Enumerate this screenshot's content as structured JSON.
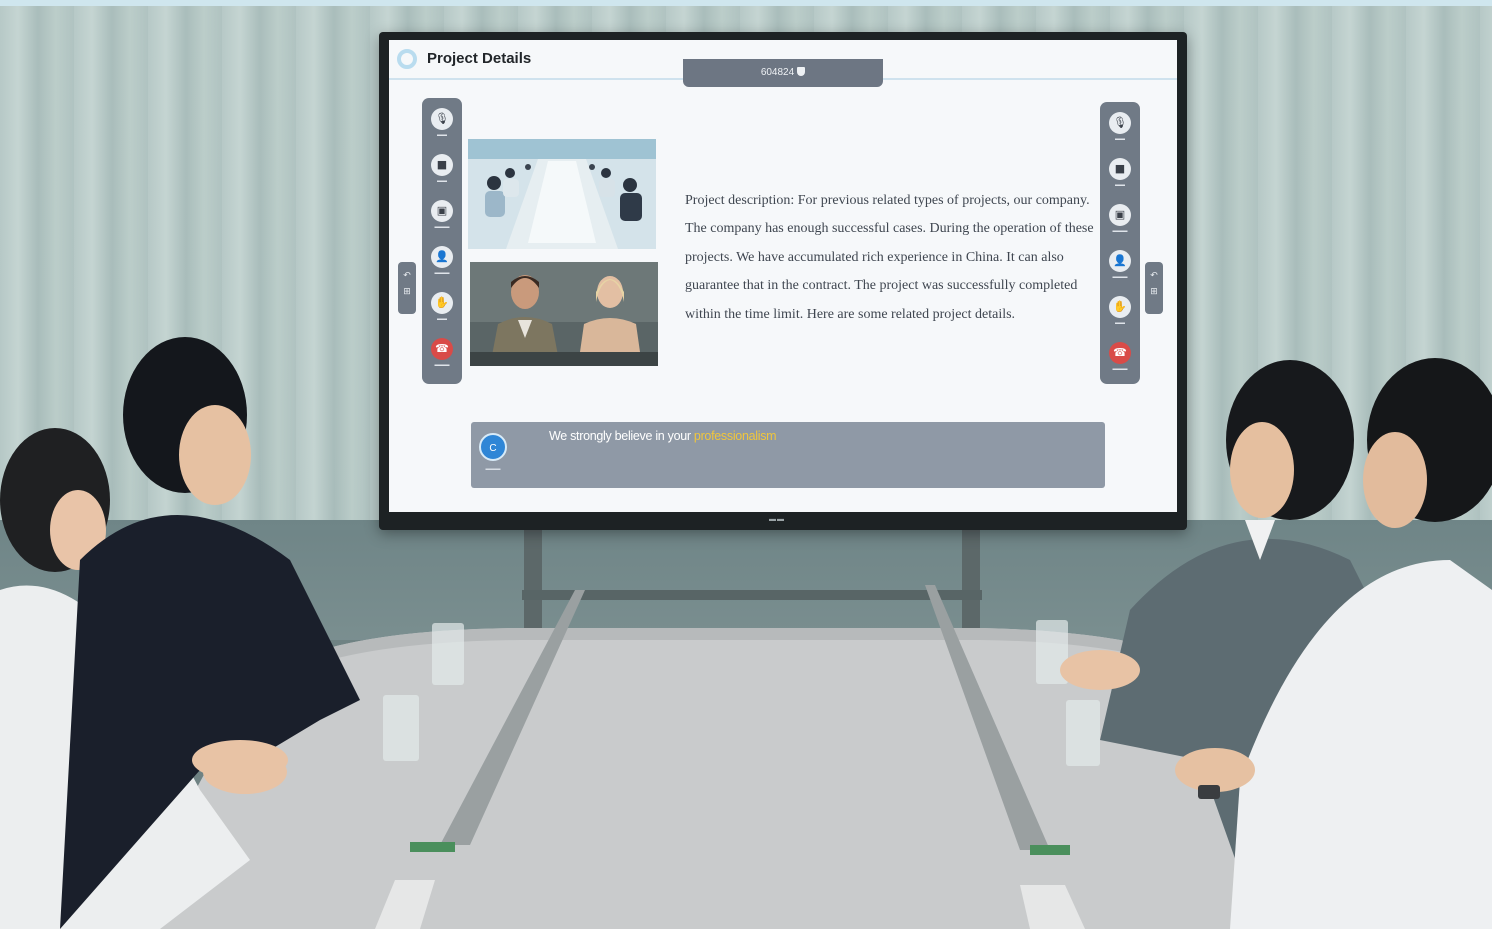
{
  "app": {
    "title": "Project Details",
    "meeting_id": "604824"
  },
  "toolbar_left": {
    "items": [
      {
        "icon": "microphone-icon",
        "glyph": "🎙"
      },
      {
        "icon": "camera-icon",
        "glyph": "■"
      },
      {
        "icon": "share-screen-icon",
        "glyph": "▣"
      },
      {
        "icon": "participants-icon",
        "glyph": "👤"
      },
      {
        "icon": "hand-icon",
        "glyph": "✋"
      },
      {
        "icon": "end-call-icon",
        "glyph": "☎"
      }
    ]
  },
  "toolbar_right": {
    "items": [
      {
        "icon": "microphone-icon",
        "glyph": "🎙"
      },
      {
        "icon": "camera-icon",
        "glyph": "■"
      },
      {
        "icon": "share-screen-icon",
        "glyph": "▣"
      },
      {
        "icon": "participants-icon",
        "glyph": "👤"
      },
      {
        "icon": "hand-icon",
        "glyph": "✋"
      },
      {
        "icon": "end-call-icon",
        "glyph": "☎"
      }
    ]
  },
  "description": {
    "text": "Project description: For previous related types of projects, our company. The company has enough successful cases. During the operation of these projects. We have accumulated rich experience in China. It can also guarantee that in the contract. The project was successfully completed within the time limit. Here are some related project details."
  },
  "caption": {
    "speaker_initial": "C",
    "text_plain": "We strongly believe in your ",
    "text_highlight": "professionalism"
  },
  "colors": {
    "accent_blue": "#2f86d6",
    "highlight_yellow": "#f0c63c",
    "toolbar_gray": "#707a86",
    "end_call_red": "#d94b48"
  }
}
